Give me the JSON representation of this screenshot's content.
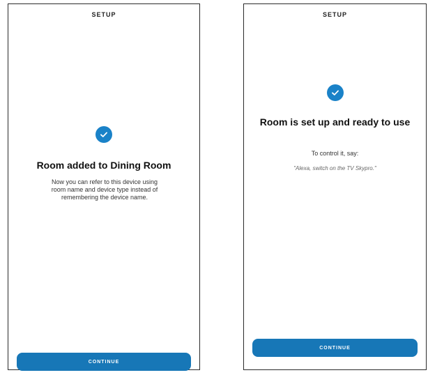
{
  "screens": [
    {
      "header": "SETUP",
      "title": "Room added to Dining Room",
      "body": "Now you can refer to this device using room name and device type instead of remembering the device name.",
      "button": "CONTINUE",
      "check_icon": "check-circle-icon"
    },
    {
      "header": "SETUP",
      "title": "Room is set up and ready to use",
      "body": "To control it, say:",
      "example": "\"Alexa, switch on the TV Skypro.\"",
      "button": "CONTINUE",
      "check_icon": "check-circle-icon"
    }
  ],
  "colors": {
    "accent": "#1a82c8",
    "button": "#1777b7"
  }
}
